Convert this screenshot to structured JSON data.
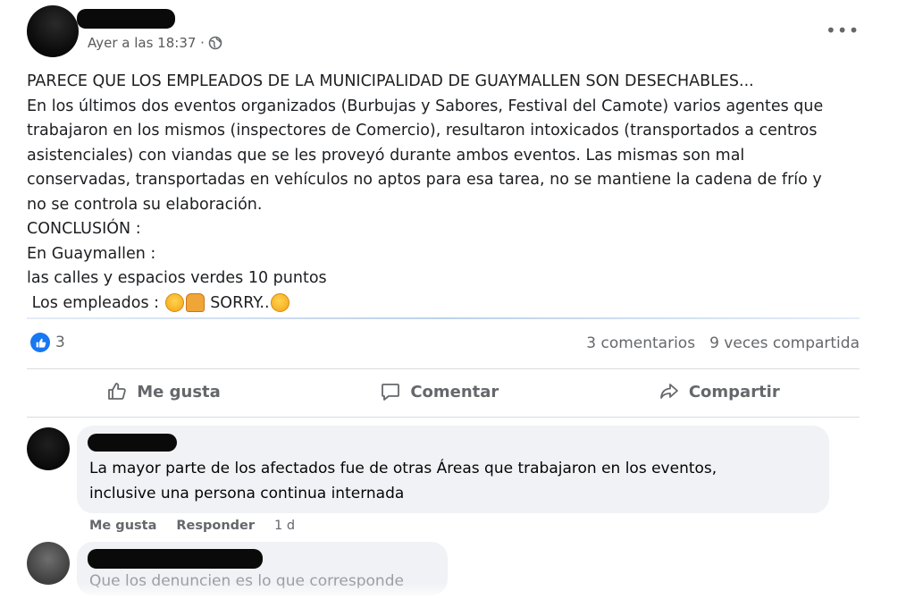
{
  "post": {
    "timestamp": "Ayer a las 18:37 ·",
    "more_label": "•••",
    "lines": [
      "PARECE QUE LOS EMPLEADOS DE LA MUNICIPALIDAD DE GUAYMALLEN SON DESECHABLES...",
      "En los últimos dos eventos organizados (Burbujas y Sabores, Festival del Camote) varios agentes que",
      "trabajaron en los mismos (inspectores de Comercio), resultaron intoxicados (transportados a centros",
      "asistenciales) con viandas que se les proveyó durante ambos eventos. Las mismas son mal",
      "conservadas,  transportadas en vehículos no aptos para esa tarea, no se mantiene la cadena de frío y",
      "no se controla su elaboración.",
      "CONCLUSIÓN :",
      "En Guaymallen :",
      "las calles y espacios verdes 10 puntos"
    ],
    "last_line_prefix": " Los empleados : ",
    "last_line_mid": " SORRY..",
    "emoji_icons": [
      "fearful-face-emoji",
      "person-gesturing-no-emoji",
      "yawning-face-emoji"
    ]
  },
  "reactions": {
    "like_count": "3",
    "comments": "3 comentarios",
    "shares": "9 veces compartida"
  },
  "actions": {
    "like": "Me gusta",
    "comment": "Comentar",
    "share": "Compartir"
  },
  "comments": [
    {
      "line1": "La mayor parte de los afectados fue de otras Áreas que trabajaron en los eventos,",
      "line2": "inclusive una persona continua internada",
      "like": "Me gusta",
      "reply": "Responder",
      "time": "1 d"
    },
    {
      "text": "Que los denuncien es lo que corresponde"
    }
  ],
  "colors": {
    "accent": "#1877f2",
    "muted": "#65676b",
    "bubble": "#f0f2f5"
  }
}
